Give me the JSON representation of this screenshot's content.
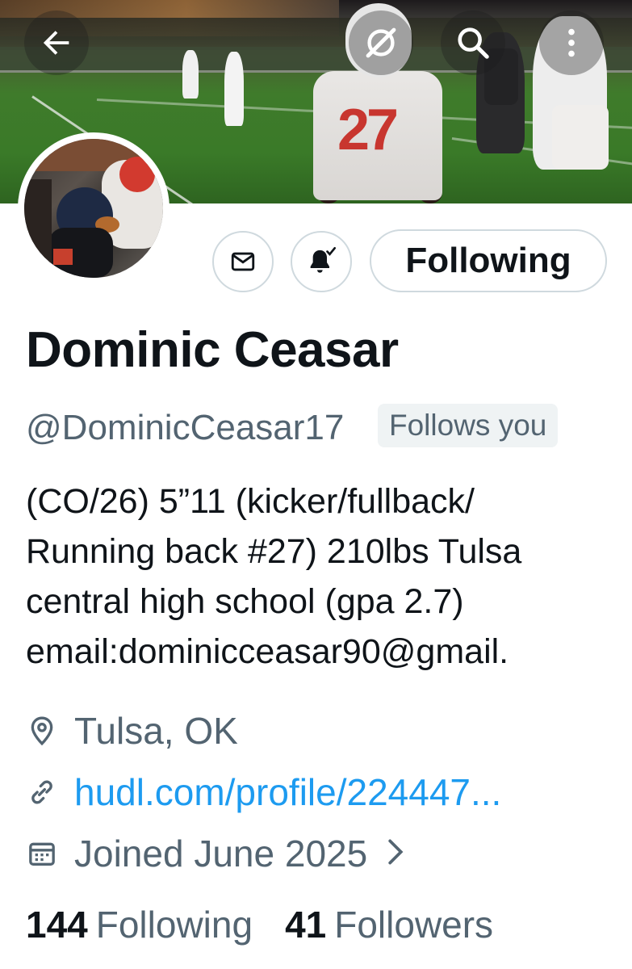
{
  "header": {
    "back_icon": "arrow-left-icon",
    "grok_icon": "grok-icon",
    "search_icon": "search-icon",
    "more_icon": "more-vertical-icon",
    "banner_jersey_number": "27"
  },
  "actions": {
    "message_icon": "envelope-icon",
    "notify_icon": "bell-check-icon",
    "follow_label": "Following"
  },
  "profile": {
    "display_name": "Dominic Ceasar",
    "handle": "@DominicCeasar17",
    "follows_you": "Follows you",
    "bio_lines": [
      "(CO/26) 5”11 (kicker/fullback/",
      "Running back #27) 210lbs Tulsa",
      "central high school (gpa 2.7)",
      "email:dominicceasar90@gmail."
    ],
    "location": "Tulsa, OK",
    "website": "hudl.com/profile/224447...",
    "joined": "Joined June 2025"
  },
  "stats": {
    "following_count": "144",
    "following_label": "Following",
    "followers_count": "41",
    "followers_label": "Followers"
  },
  "colors": {
    "text_primary": "#0f1419",
    "text_secondary": "#536471",
    "link": "#1d9bf0",
    "border": "#cfd9de",
    "badge_bg": "#eff3f4"
  }
}
